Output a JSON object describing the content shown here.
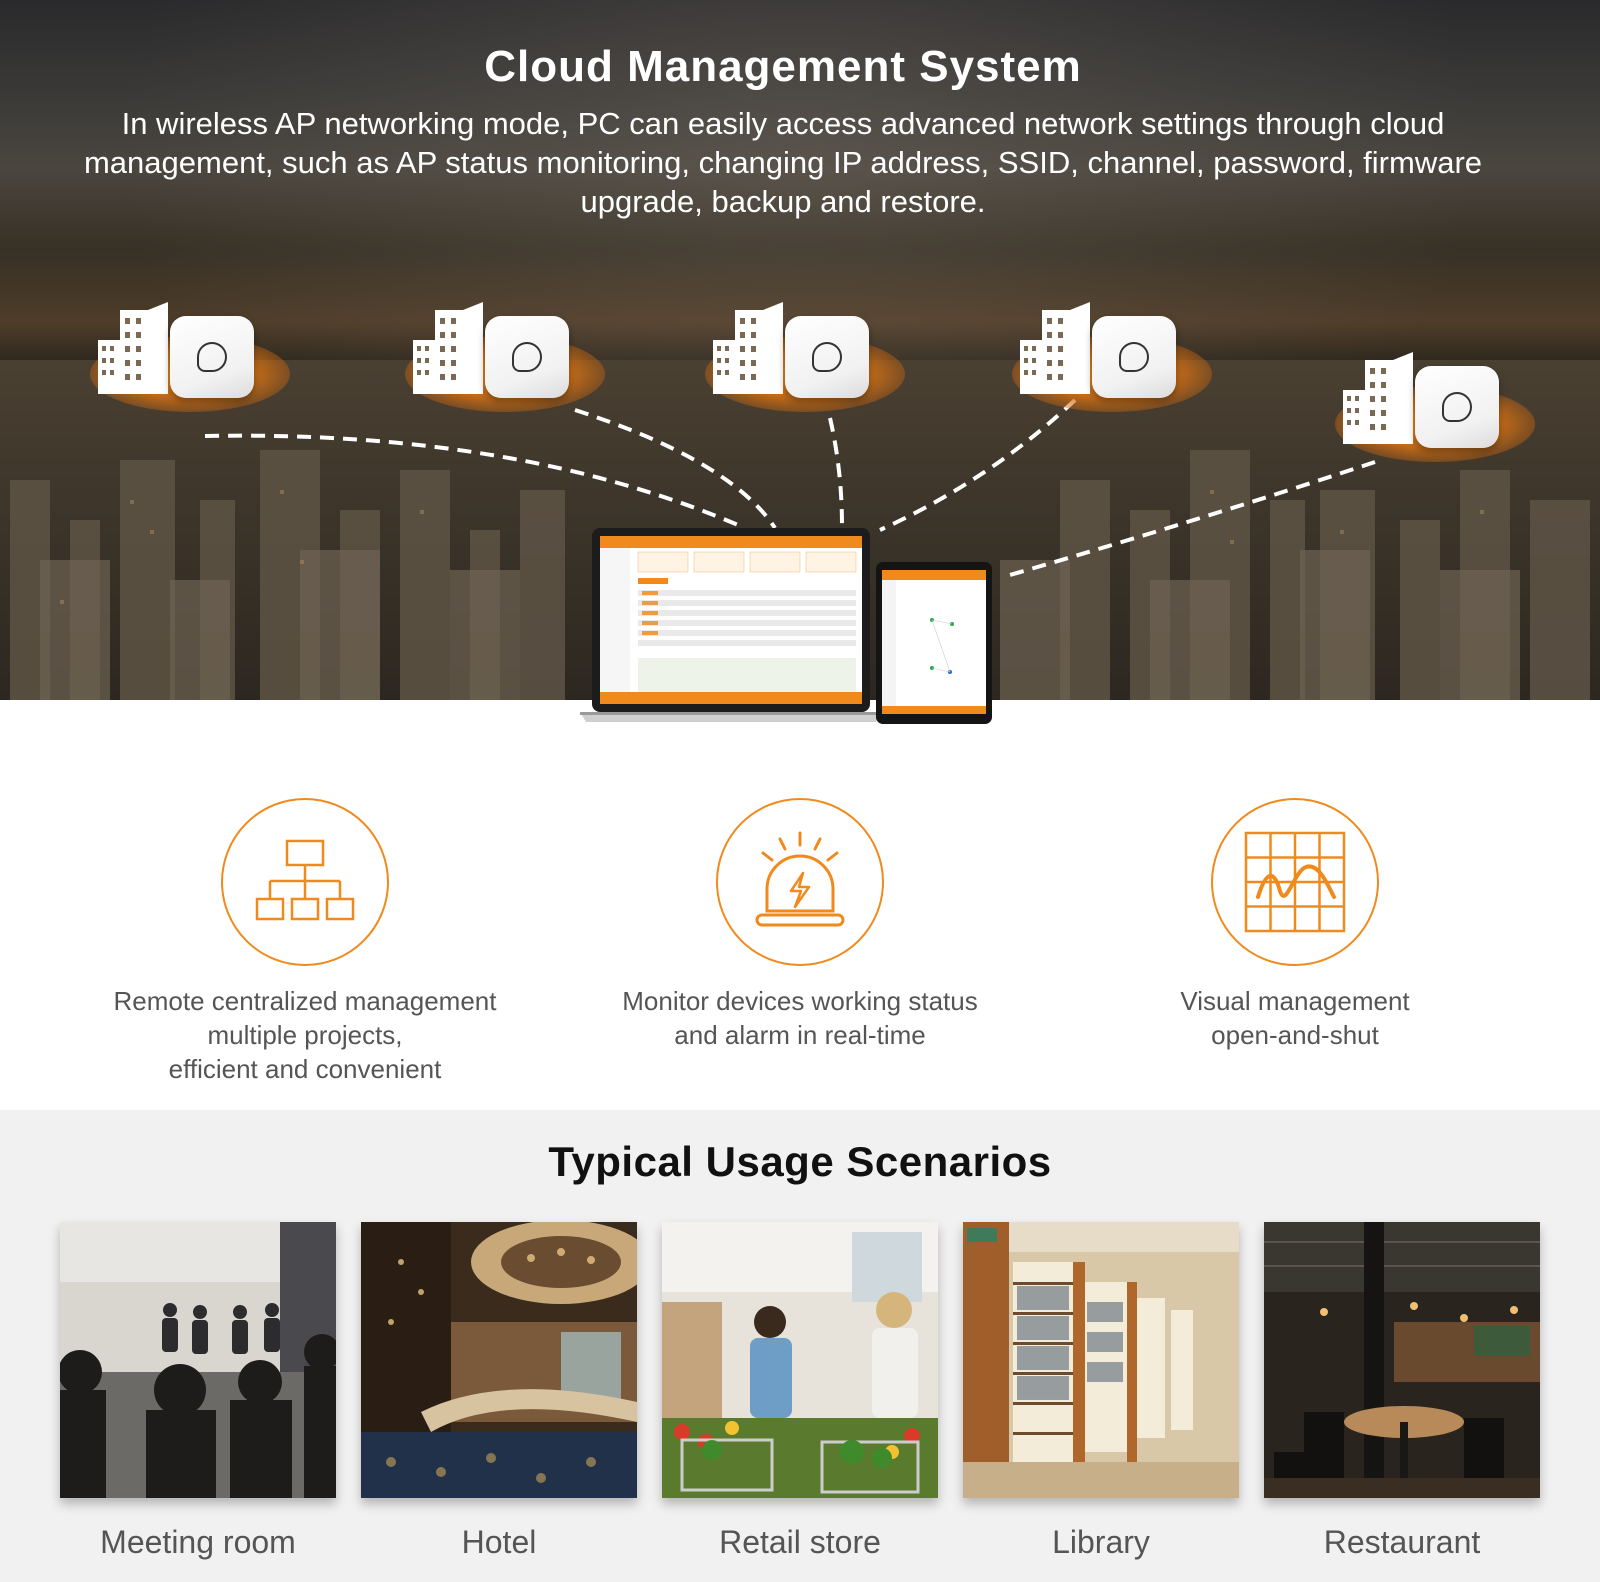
{
  "hero": {
    "title": "Cloud Management System",
    "description": "In wireless AP networking mode, PC can easily access advanced network settings through cloud management, such as AP status monitoring, changing IP address, SSID, channel, password, firmware upgrade, backup and restore.",
    "accent_color": "#f08a1c",
    "ap_nodes": [
      {
        "icon": "building-icon",
        "device": "access-point"
      },
      {
        "icon": "building-icon",
        "device": "access-point"
      },
      {
        "icon": "building-icon",
        "device": "access-point"
      },
      {
        "icon": "building-icon",
        "device": "access-point"
      },
      {
        "icon": "building-icon",
        "device": "access-point"
      }
    ],
    "devices": [
      "laptop",
      "tablet"
    ]
  },
  "features": [
    {
      "icon": "hierarchy-icon",
      "caption": "Remote centralized management\nmultiple projects,\nefficient and convenient"
    },
    {
      "icon": "alarm-light-icon",
      "caption": "Monitor devices working status\nand alarm in real-time"
    },
    {
      "icon": "chart-grid-icon",
      "caption": "Visual management\nopen-and-shut"
    }
  ],
  "scenarios": {
    "title": "Typical Usage Scenarios",
    "items": [
      {
        "label": "Meeting room"
      },
      {
        "label": "Hotel"
      },
      {
        "label": "Retail store"
      },
      {
        "label": "Library"
      },
      {
        "label": "Restaurant"
      }
    ]
  }
}
